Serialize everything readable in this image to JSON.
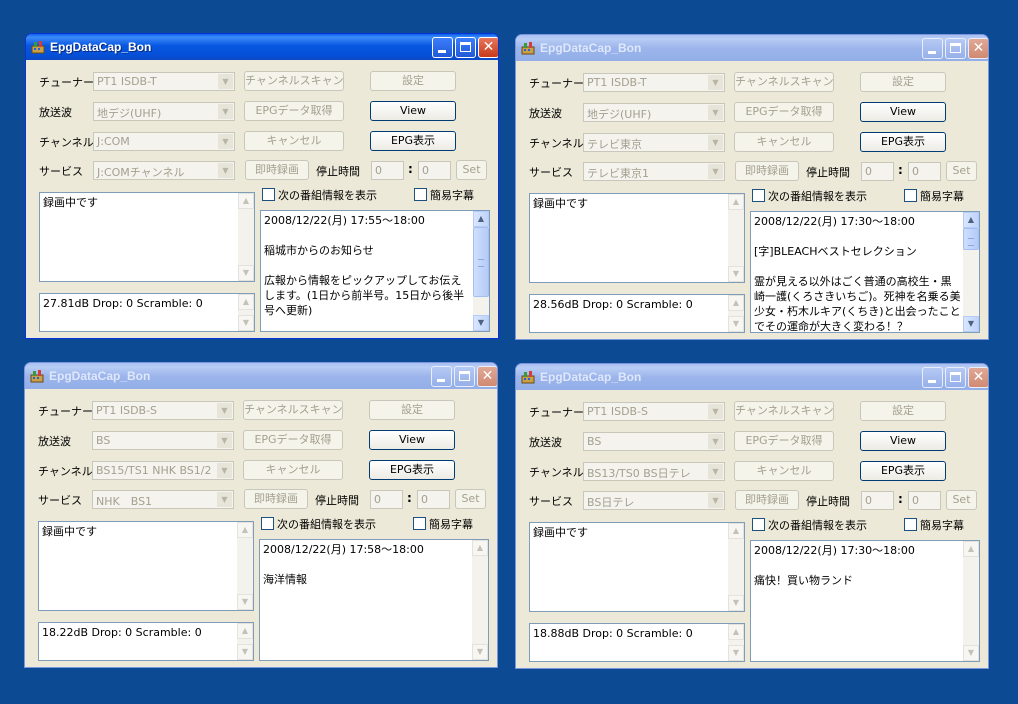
{
  "labels": {
    "tuner": "チューナー",
    "broadcast": "放送波",
    "channel": "チャンネル",
    "service": "サービス",
    "stop_time": "停止時間",
    "colon": ":"
  },
  "buttons": {
    "channel_scan": "チャンネルスキャン",
    "settings": "設定",
    "epg_get": "EPGデータ取得",
    "view": "View",
    "cancel": "キャンセル",
    "epg_show": "EPG表示",
    "instant_rec": "即時録画",
    "set": "Set"
  },
  "checkboxes": {
    "next_program": "次の番組情報を表示",
    "simple_caption": "簡易字幕"
  },
  "windows": [
    {
      "title": "EpgDataCap_Bon",
      "tuner": "PT1 ISDB-T",
      "broadcast": "地デジ(UHF)",
      "channel": "J:COM",
      "service": "J:COMチャンネル",
      "stop_hour": "0",
      "stop_min": "0",
      "status": "録画中です",
      "signal": "27.81dB Drop: 0 Scramble: 0",
      "epg": "2008/12/22(月) 17:55～18:00\n\n稲城市からのお知らせ\n\n広報から情報をピックアップしてお伝えします。(1日から前半号。15日から後半号へ更新)"
    },
    {
      "title": "EpgDataCap_Bon",
      "tuner": "PT1 ISDB-T",
      "broadcast": "地デジ(UHF)",
      "channel": "テレビ東京",
      "service": "テレビ東京1",
      "stop_hour": "0",
      "stop_min": "0",
      "status": "録画中です",
      "signal": "28.56dB Drop: 0 Scramble: 0",
      "epg": "2008/12/22(月) 17:30～18:00\n\n[字]BLEACHベストセレクション\n\n霊が見える以外はごく普通の高校生・黒崎一護(くろさきいちご)。死神を名乗る美少女・朽木ルキア(くちき)と出会ったことでその運命が大きく変わる！？"
    },
    {
      "title": "EpgDataCap_Bon",
      "tuner": "PT1 ISDB-S",
      "broadcast": "BS",
      "channel": "BS15/TS1 NHK BS1/2",
      "service": "NHK　BS1",
      "stop_hour": "0",
      "stop_min": "0",
      "status": "録画中です",
      "signal": "18.22dB Drop: 0 Scramble: 0",
      "epg": "2008/12/22(月) 17:58～18:00\n\n海洋情報"
    },
    {
      "title": "EpgDataCap_Bon",
      "tuner": "PT1 ISDB-S",
      "broadcast": "BS",
      "channel": "BS13/TS0 BS日テレ",
      "service": "BS日テレ",
      "stop_hour": "0",
      "stop_min": "0",
      "status": "録画中です",
      "signal": "18.88dB Drop: 0 Scramble: 0",
      "epg": "2008/12/22(月) 17:30～18:00\n\n痛快！買い物ランド"
    }
  ]
}
